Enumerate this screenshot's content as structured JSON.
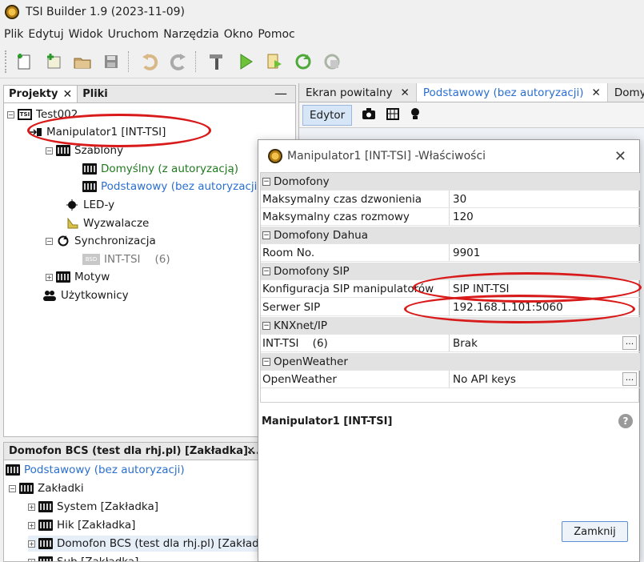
{
  "window": {
    "title": "TSI Builder 1.9 (2023-11-09)"
  },
  "menu": [
    "Plik",
    "Edytuj",
    "Widok",
    "Uruchom",
    "Narzędzia",
    "Okno",
    "Pomoc"
  ],
  "toolbar_icons": [
    "new-project-icon",
    "add-icon",
    "open-icon",
    "save-icon",
    "undo-icon",
    "redo-icon",
    "build-hammer-icon",
    "run-icon",
    "export-icon",
    "sync-icon",
    "sync-disabled-icon"
  ],
  "left_panel": {
    "tabs": [
      {
        "label": "Projekty",
        "close": "✕"
      },
      {
        "label": "Pliki"
      }
    ],
    "minimize": "—",
    "tree": {
      "root": "Test002",
      "manipulator": "Manipulator1 [INT-TSI]",
      "szablony": "Szablony",
      "template_default": "Domyślny (z autoryzacją)",
      "template_basic": "Podstawowy (bez autoryzacji)",
      "leds": "LED-y",
      "triggers": "Wyzwalacze",
      "sync": "Synchronizacja",
      "sync_child": "INT-TSI",
      "sync_child_count": "(6)",
      "theme": "Motyw",
      "users": "Użytkownicy"
    }
  },
  "right_tabs": [
    {
      "label": "Ekran powitalny",
      "close": "✕"
    },
    {
      "label": "Podstawowy (bez autoryzacji)",
      "close": "✕"
    },
    {
      "label": "Domyślny"
    }
  ],
  "editor": {
    "label": "Edytor"
  },
  "lower_panel": {
    "title": "Domofon BCS (test dla rhj.pl) [Zakładka]...",
    "close": "✕",
    "items": {
      "root": "Podstawowy (bez autoryzacji)",
      "tabs_group": "Zakładki",
      "tab1": "System [Zakładka]",
      "tab2": "Hik [Zakładka]",
      "tab3": "Domofon BCS (test dla rhj.pl) [Zakładka]",
      "tab4": "Sub [Zakładka]"
    }
  },
  "dialog": {
    "title": "Manipulator1 [INT-TSI] -Właściwości",
    "close": "✕",
    "sections": {
      "domofony": "Domofony",
      "max_ring_label": "Maksymalny czas dzwonienia",
      "max_ring_value": "30",
      "max_talk_label": "Maksymalny czas rozmowy",
      "max_talk_value": "120",
      "dahua": "Domofony Dahua",
      "room_label": "Room No.",
      "room_value": "9901",
      "sip": "Domofony SIP",
      "sip_cfg_label": "Konfiguracja SIP manipulatorów",
      "sip_cfg_value": "SIP INT-TSI",
      "sip_server_label": "Serwer SIP",
      "sip_server_value": "192.168.1.101:5060",
      "knx": "KNXnet/IP",
      "knx_label": "INT-TSI    (6)",
      "knx_value": "Brak",
      "ow": "OpenWeather",
      "ow_label": "OpenWeather",
      "ow_value": "No API keys",
      "dots": "..."
    },
    "description_title": "Manipulator1 [INT-TSI]",
    "help": "?",
    "close_button": "Zamknij"
  },
  "colors": {
    "annotation_red": "#d91a1a",
    "link_blue": "#2a6fd0",
    "tree_green": "#1e7a1e"
  }
}
